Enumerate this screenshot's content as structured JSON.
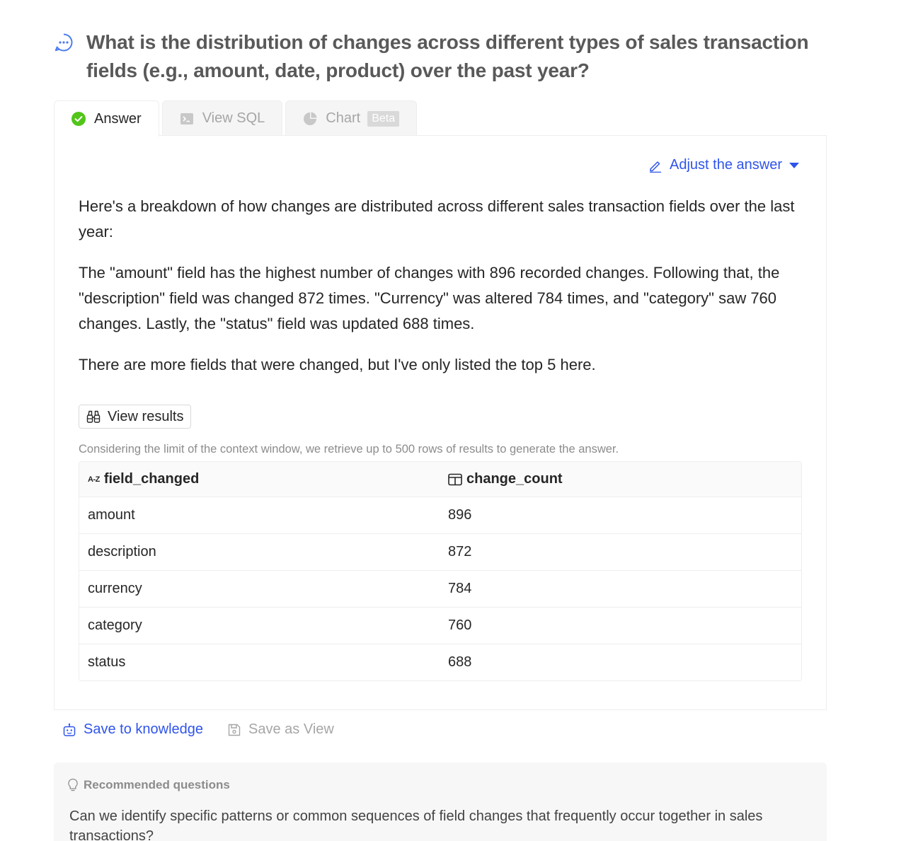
{
  "question": {
    "text": "What is the distribution of changes across different types of sales transaction fields (e.g., amount, date, product) over the past year?"
  },
  "tabs": [
    {
      "label": "Answer"
    },
    {
      "label": "View SQL"
    },
    {
      "label": "Chart",
      "badge": "Beta"
    }
  ],
  "adjust": {
    "label": "Adjust the answer"
  },
  "answer": {
    "paragraphs": [
      "Here's a breakdown of how changes are distributed across different sales transaction fields over the last year:",
      "The \"amount\" field has the highest number of changes with 896 recorded changes. Following that, the \"description\" field was changed 872 times. \"Currency\" was altered 784 times, and \"category\" saw 760 changes. Lastly, the \"status\" field was updated 688 times.",
      "There are more fields that were changed, but I've only listed the top 5 here."
    ]
  },
  "view_results": {
    "label": "View results"
  },
  "context_note": "Considering the limit of the context window, we retrieve up to 500 rows of results to generate the answer.",
  "table": {
    "az_icon": "A-Z",
    "headers": [
      "field_changed",
      "change_count"
    ],
    "rows": [
      [
        "amount",
        "896"
      ],
      [
        "description",
        "872"
      ],
      [
        "currency",
        "784"
      ],
      [
        "category",
        "760"
      ],
      [
        "status",
        "688"
      ]
    ]
  },
  "actions": {
    "save_knowledge": "Save to knowledge",
    "save_view": "Save as View"
  },
  "recommended": {
    "title": "Recommended questions",
    "items": [
      "Can we identify specific patterns or common sequences of field changes that frequently occur together in sales transactions?"
    ]
  },
  "colors": {
    "accent": "#2f54eb",
    "success": "#52c41a",
    "question_icon": "#4a7cf0"
  }
}
